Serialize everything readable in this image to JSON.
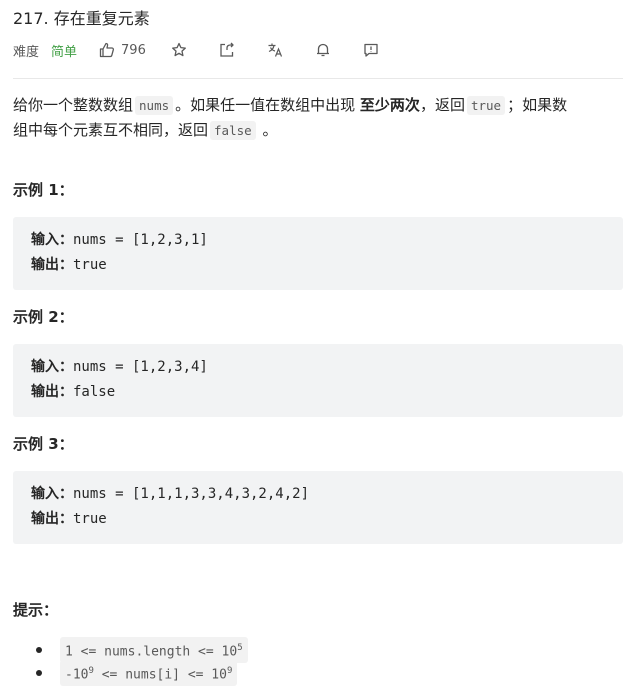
{
  "problem": {
    "title": "217. 存在重复元素",
    "difficulty_label": "难度",
    "difficulty": "简单",
    "likes": "796",
    "icons": [
      "thumbs-up-icon",
      "star-icon",
      "share-icon",
      "translate-icon",
      "bell-icon",
      "feedback-icon"
    ]
  },
  "description": {
    "p1": "给你一个整数数组",
    "code_nums": "nums",
    "p2": "。如果任一值在数组中出现",
    "bold": "至少两次",
    "p3": "，返回",
    "code_true": "true",
    "p4": "；如果数",
    "p5": "组中每个元素互不相同，返回",
    "code_false": "false",
    "p6": "。"
  },
  "examples": [
    {
      "heading": "示例 1：",
      "input_label": "输入：",
      "input": "nums = [1,2,3,1]",
      "output_label": "输出：",
      "output": "true"
    },
    {
      "heading": "示例 2：",
      "input_label": "输入：",
      "input": "nums = [1,2,3,4]",
      "output_label": "输出：",
      "output": "false"
    },
    {
      "heading": "示例 3：",
      "input_label": "输入：",
      "input": "nums = [1,1,1,3,3,4,3,2,4,2]",
      "output_label": "输出：",
      "output": "true"
    }
  ],
  "tips": {
    "heading": "提示：",
    "items": [
      {
        "pre": "1 <= nums.length <= 10",
        "sup": "5",
        "mid": "",
        "sup2": ""
      },
      {
        "pre": "-10",
        "sup": "9",
        "mid": " <= nums[i] <= 10",
        "sup2": "9"
      }
    ]
  },
  "colors": {
    "easy": "#43a047",
    "code_bg": "#f2f3f4",
    "text": "#262626"
  }
}
